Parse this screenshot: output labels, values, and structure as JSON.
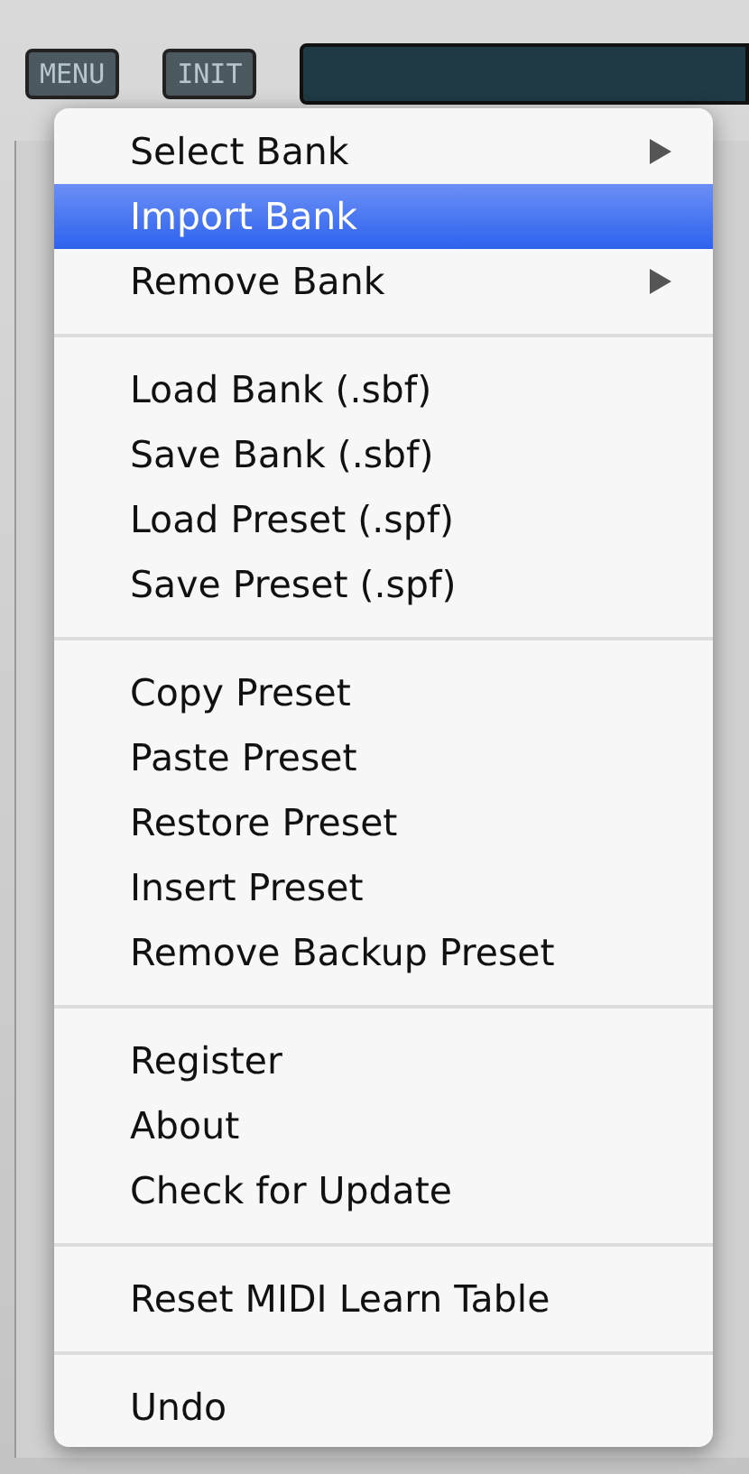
{
  "toolbar": {
    "buttons": [
      {
        "label": "MENU"
      },
      {
        "label": "INIT"
      }
    ]
  },
  "menu": {
    "groups": [
      [
        {
          "label": "Select Bank",
          "submenu": true,
          "selected": false
        },
        {
          "label": "Import Bank",
          "submenu": false,
          "selected": true
        },
        {
          "label": "Remove Bank",
          "submenu": true,
          "selected": false
        }
      ],
      [
        {
          "label": "Load Bank (.sbf)",
          "submenu": false,
          "selected": false
        },
        {
          "label": "Save Bank (.sbf)",
          "submenu": false,
          "selected": false
        },
        {
          "label": "Load Preset (.spf)",
          "submenu": false,
          "selected": false
        },
        {
          "label": "Save Preset (.spf)",
          "submenu": false,
          "selected": false
        }
      ],
      [
        {
          "label": "Copy Preset",
          "submenu": false,
          "selected": false
        },
        {
          "label": "Paste Preset",
          "submenu": false,
          "selected": false
        },
        {
          "label": "Restore Preset",
          "submenu": false,
          "selected": false
        },
        {
          "label": "Insert Preset",
          "submenu": false,
          "selected": false
        },
        {
          "label": "Remove Backup Preset",
          "submenu": false,
          "selected": false
        }
      ],
      [
        {
          "label": "Register",
          "submenu": false,
          "selected": false
        },
        {
          "label": "About",
          "submenu": false,
          "selected": false
        },
        {
          "label": "Check for Update",
          "submenu": false,
          "selected": false
        }
      ],
      [
        {
          "label": "Reset MIDI Learn Table",
          "submenu": false,
          "selected": false
        }
      ],
      [
        {
          "label": "Undo",
          "submenu": false,
          "selected": false
        }
      ]
    ]
  }
}
